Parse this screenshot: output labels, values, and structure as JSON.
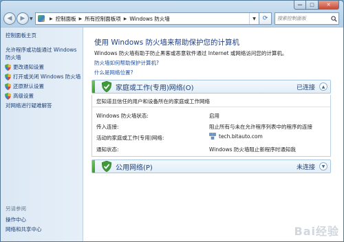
{
  "window": {
    "caption_buttons": {
      "minimize": "—",
      "maximize": "□",
      "close": "✕"
    }
  },
  "navbar": {
    "breadcrumb": [
      "控制面板",
      "所有控制面板项",
      "Windows 防火墙"
    ],
    "search_placeholder": "搜索控制面板"
  },
  "sidebar": {
    "home": "控制面板主页",
    "items": [
      {
        "label": "允许程序或功能通过 Windows 防火墙",
        "icon": "none"
      },
      {
        "label": "更改通知设置",
        "icon": "shield-icon"
      },
      {
        "label": "打开或关闭 Windows 防火墙",
        "icon": "shield-icon"
      },
      {
        "label": "还原默认设置",
        "icon": "shield-icon"
      },
      {
        "label": "高级设置",
        "icon": "shield-icon"
      },
      {
        "label": "对网络进行疑难解答",
        "icon": "none"
      }
    ],
    "see_also": "另请参阅",
    "see_also_links": [
      "操作中心",
      "网络和共享中心"
    ]
  },
  "main": {
    "title": "使用 Windows 防火墙来帮助保护您的计算机",
    "description": "Windows 防火墙有助于防止黑客或恶意软件通过 Internet 或网络访问您的计算机。",
    "link_help": "防火墙如何帮助保护计算机?",
    "link_locations": "什么是网络位置?",
    "home_network": {
      "title": "家庭或工作(专用)网络(O)",
      "status": "已连接",
      "intro": "您知道且信任的用户和设备所在的家庭或工作网络",
      "rows": [
        {
          "label": "Windows 防火墙状态:",
          "value": "启用"
        },
        {
          "label": "传入连接:",
          "value": "阻止所有与未在允许程序列表中的程序的连接"
        },
        {
          "label": "活动的家庭或工作(专用)网络:",
          "value": "tech.bitauto.com"
        },
        {
          "label": "通知状态:",
          "value": "Windows 防火墙阻止新程序时通知我"
        }
      ]
    },
    "public_network": {
      "title": "公用网络(P)",
      "status": "未连接"
    }
  },
  "colors": {
    "accent_green": "#3c9a37",
    "link_blue": "#1e4fa3",
    "title_blue": "#1c3f8a"
  }
}
